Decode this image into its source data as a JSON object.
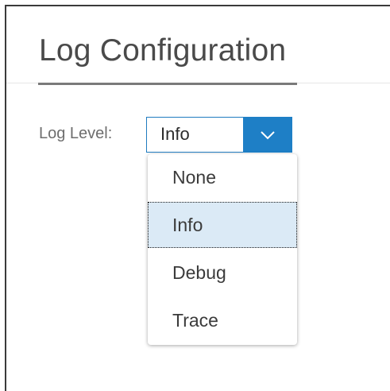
{
  "page": {
    "title": "Log Configuration"
  },
  "log_level": {
    "label": "Log Level:",
    "selected_value": "Info",
    "options": [
      "None",
      "Info",
      "Debug",
      "Trace"
    ],
    "selected_index": 1
  },
  "colors": {
    "accent": "#1e7fc6",
    "selected_option_bg": "#dbeaf6",
    "title_text": "#4a4a4a",
    "label_text": "#6e6e6e"
  },
  "icons": {
    "dropdown_toggle": "chevron-down-icon"
  }
}
